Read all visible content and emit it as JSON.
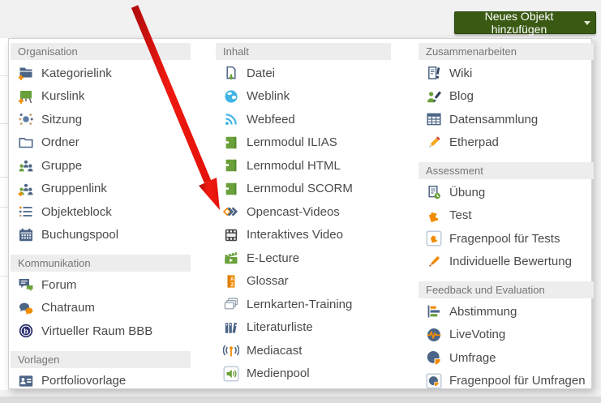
{
  "button": {
    "label": "Neues Objekt hinzufügen",
    "caret_icon": "caret-down-icon"
  },
  "colors": {
    "button_green": "#3a5a14",
    "icon_slate_blue": "#4c6586",
    "icon_green": "#69a03a",
    "icon_orange": "#f08c00",
    "icon_light_blue": "#41b4e5",
    "arrow_red": "#e3120b",
    "section_header_bg": "#ededed"
  },
  "annotation": {
    "type": "red-arrow",
    "points_to": "Opencast-Videos"
  },
  "menu": {
    "columns": [
      {
        "sections": [
          {
            "title": "Organisation",
            "items": [
              {
                "label": "Kategorielink",
                "icon": "category-link-icon"
              },
              {
                "label": "Kurslink",
                "icon": "course-link-icon"
              },
              {
                "label": "Sitzung",
                "icon": "session-icon"
              },
              {
                "label": "Ordner",
                "icon": "folder-icon"
              },
              {
                "label": "Gruppe",
                "icon": "group-icon"
              },
              {
                "label": "Gruppenlink",
                "icon": "group-link-icon"
              },
              {
                "label": "Objekteblock",
                "icon": "item-group-icon"
              },
              {
                "label": "Buchungspool",
                "icon": "booking-pool-icon"
              }
            ]
          },
          {
            "title": "Kommunikation",
            "items": [
              {
                "label": "Forum",
                "icon": "forum-icon"
              },
              {
                "label": "Chatraum",
                "icon": "chatroom-icon"
              },
              {
                "label": "Virtueller Raum BBB",
                "icon": "bbb-room-icon"
              }
            ]
          },
          {
            "title": "Vorlagen",
            "items": [
              {
                "label": "Portfoliovorlage",
                "icon": "portfolio-template-icon"
              }
            ]
          }
        ]
      },
      {
        "sections": [
          {
            "title": "Inhalt",
            "items": [
              {
                "label": "Datei",
                "icon": "file-icon"
              },
              {
                "label": "Weblink",
                "icon": "weblink-icon"
              },
              {
                "label": "Webfeed",
                "icon": "webfeed-icon"
              },
              {
                "label": "Lernmodul ILIAS",
                "icon": "learning-module-icon"
              },
              {
                "label": "Lernmodul HTML",
                "icon": "learning-module-icon"
              },
              {
                "label": "Lernmodul SCORM",
                "icon": "learning-module-icon"
              },
              {
                "label": "Opencast-Videos",
                "icon": "opencast-icon"
              },
              {
                "label": "Interaktives Video",
                "icon": "interactive-video-icon"
              },
              {
                "label": "E-Lecture",
                "icon": "e-lecture-icon"
              },
              {
                "label": "Glossar",
                "icon": "glossary-icon"
              },
              {
                "label": "Lernkarten-Training",
                "icon": "flashcards-icon"
              },
              {
                "label": "Literaturliste",
                "icon": "literature-list-icon"
              },
              {
                "label": "Mediacast",
                "icon": "mediacast-icon"
              },
              {
                "label": "Medienpool",
                "icon": "media-pool-icon"
              }
            ]
          }
        ]
      },
      {
        "sections": [
          {
            "title": "Zusammenarbeiten",
            "items": [
              {
                "label": "Wiki",
                "icon": "wiki-icon"
              },
              {
                "label": "Blog",
                "icon": "blog-icon"
              },
              {
                "label": "Datensammlung",
                "icon": "data-collection-icon"
              },
              {
                "label": "Etherpad",
                "icon": "etherpad-icon"
              }
            ]
          },
          {
            "title": "Assessment",
            "items": [
              {
                "label": "Übung",
                "icon": "exercise-icon"
              },
              {
                "label": "Test",
                "icon": "test-icon"
              },
              {
                "label": "Fragenpool für Tests",
                "icon": "question-pool-test-icon"
              },
              {
                "label": "Individuelle Bewertung",
                "icon": "individual-assessment-icon"
              }
            ]
          },
          {
            "title": "Feedback und Evaluation",
            "items": [
              {
                "label": "Abstimmung",
                "icon": "poll-icon"
              },
              {
                "label": "LiveVoting",
                "icon": "live-voting-icon"
              },
              {
                "label": "Umfrage",
                "icon": "survey-icon"
              },
              {
                "label": "Fragenpool für Umfragen",
                "icon": "question-pool-survey-icon"
              }
            ]
          }
        ]
      }
    ]
  }
}
